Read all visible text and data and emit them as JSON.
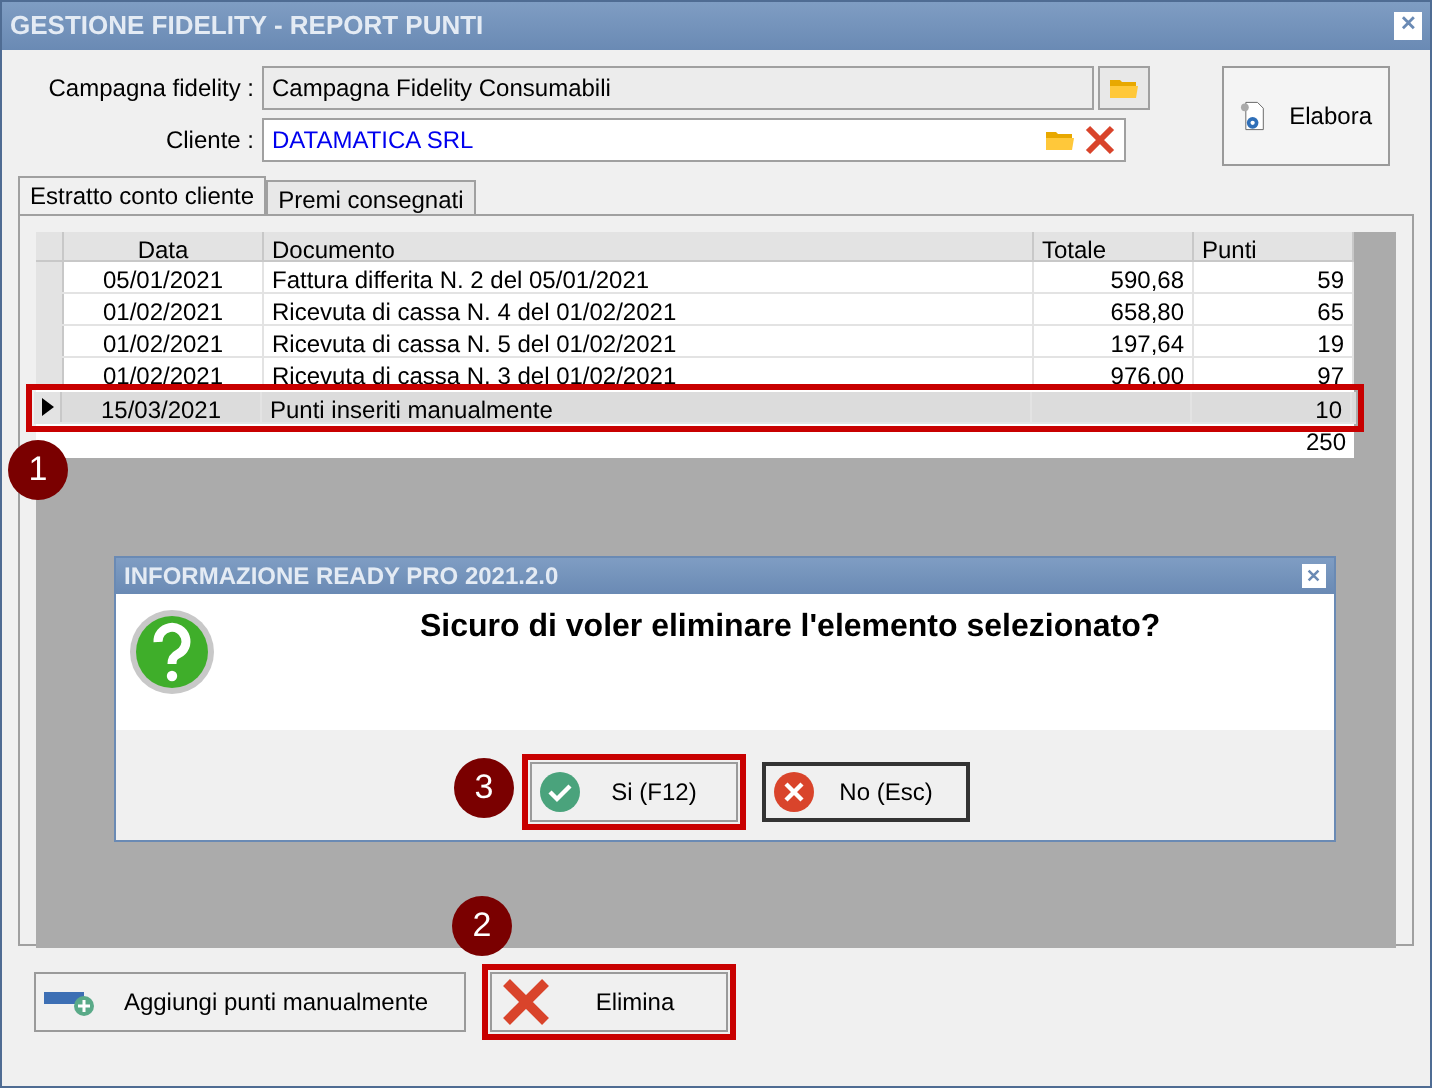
{
  "window": {
    "title": "GESTIONE FIDELITY - REPORT PUNTI",
    "close": "✕"
  },
  "fields": [
    {
      "label": "Campagna fidelity :",
      "value": "Campagna Fidelity Consumabili",
      "kind": "readonly"
    },
    {
      "label": "Cliente :",
      "value": "DATAMATICA SRL",
      "kind": "editable"
    }
  ],
  "process_button": {
    "label": "Elabora"
  },
  "tabs": [
    {
      "label": "Estratto conto cliente",
      "selected": true
    },
    {
      "label": "Premi consegnati",
      "selected": false
    }
  ],
  "table": {
    "columns": [
      "Data",
      "Documento",
      "Totale",
      "Punti"
    ],
    "rows": [
      {
        "cells": [
          "05/01/2021",
          "Fattura differita N. 2 del 05/01/2021",
          "590,68",
          "59"
        ],
        "selected": false
      },
      {
        "cells": [
          "01/02/2021",
          "Ricevuta di cassa N. 4 del 01/02/2021",
          "658,80",
          "65"
        ],
        "selected": false
      },
      {
        "cells": [
          "01/02/2021",
          "Ricevuta di cassa N. 5 del 01/02/2021",
          "197,64",
          "19"
        ],
        "selected": false
      },
      {
        "cells": [
          "01/02/2021",
          "Ricevuta di cassa N. 3 del 01/02/2021",
          "976,00",
          "97"
        ],
        "selected": false
      },
      {
        "cells": [
          "15/03/2021",
          "Punti inseriti manualmente",
          "",
          "10"
        ],
        "selected": true,
        "highlighted": true,
        "marker": "1"
      }
    ],
    "total": "250"
  },
  "dialog": {
    "title": "INFORMAZIONE READY PRO 2021.2.0",
    "close": "✕",
    "message": "Sicuro di voler eliminare l'elemento selezionato?",
    "buttons": [
      {
        "label": "Si (F12)",
        "kind": "confirm",
        "highlighted": true,
        "marker": "3"
      },
      {
        "label": "No (Esc)",
        "kind": "cancel",
        "highlighted": false
      }
    ]
  },
  "bottom_buttons": [
    {
      "label": "Aggiungi punti manualmente",
      "kind": "add",
      "highlighted": false
    },
    {
      "label": "Elimina",
      "kind": "delete",
      "highlighted": true,
      "marker": "2"
    }
  ]
}
